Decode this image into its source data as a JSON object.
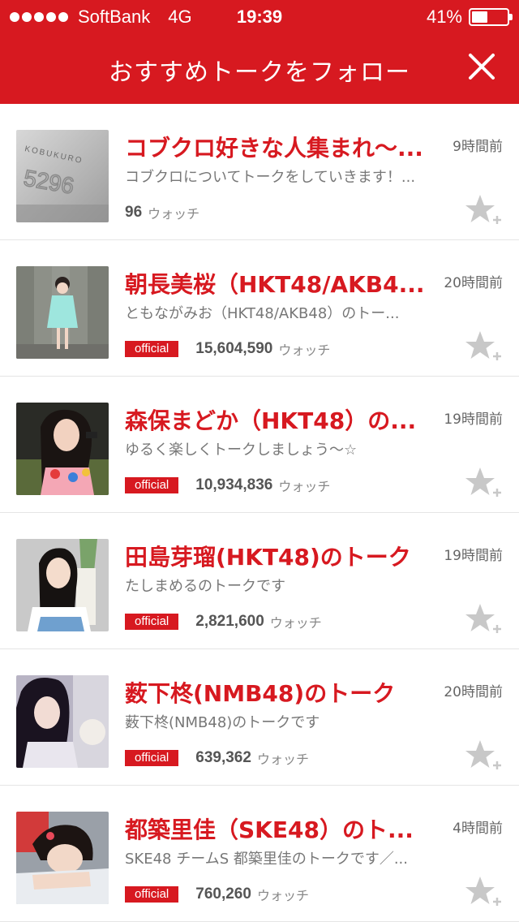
{
  "status_bar": {
    "carrier": "SoftBank",
    "network": "4G",
    "time": "19:39",
    "battery_percent": "41%",
    "battery_level": 0.41
  },
  "header": {
    "title": "おすすめトークをフォロー",
    "close_icon": "close-icon"
  },
  "talks": [
    {
      "title": "コブクロ好きな人集まれ〜...",
      "description": "コブクロについてトークをしていきます！...",
      "time": "9時間前",
      "badge": "",
      "watch_count": "96",
      "watch_label": "ウォッチ",
      "thumbnail_text": "KOBUKURO 5296"
    },
    {
      "title": "朝長美桜（HKT48/AKB4...",
      "description": "ともながみお（HKT48/AKB48）のトー...",
      "time": "20時間前",
      "badge": "official",
      "watch_count": "15,604,590",
      "watch_label": "ウォッチ"
    },
    {
      "title": "森保まどか（HKT48）の...",
      "description": "ゆるく楽しくトークしましょう〜☆",
      "time": "19時間前",
      "badge": "official",
      "watch_count": "10,934,836",
      "watch_label": "ウォッチ"
    },
    {
      "title": "田島芽瑠(HKT48)のトーク",
      "description": "たしまめるのトークです",
      "time": "19時間前",
      "badge": "official",
      "watch_count": "2,821,600",
      "watch_label": "ウォッチ"
    },
    {
      "title": "薮下柊(NMB48)のトーク",
      "description": "薮下柊(NMB48)のトークです",
      "time": "20時間前",
      "badge": "official",
      "watch_count": "639,362",
      "watch_label": "ウォッチ"
    },
    {
      "title": "都築里佳（SKE48）のト...",
      "description": "SKE48 チームS 都築里佳のトークです／...",
      "time": "4時間前",
      "badge": "official",
      "watch_count": "760,260",
      "watch_label": "ウォッチ"
    }
  ],
  "colors": {
    "accent": "#d71920",
    "star_inactive": "#c8c8c8"
  }
}
